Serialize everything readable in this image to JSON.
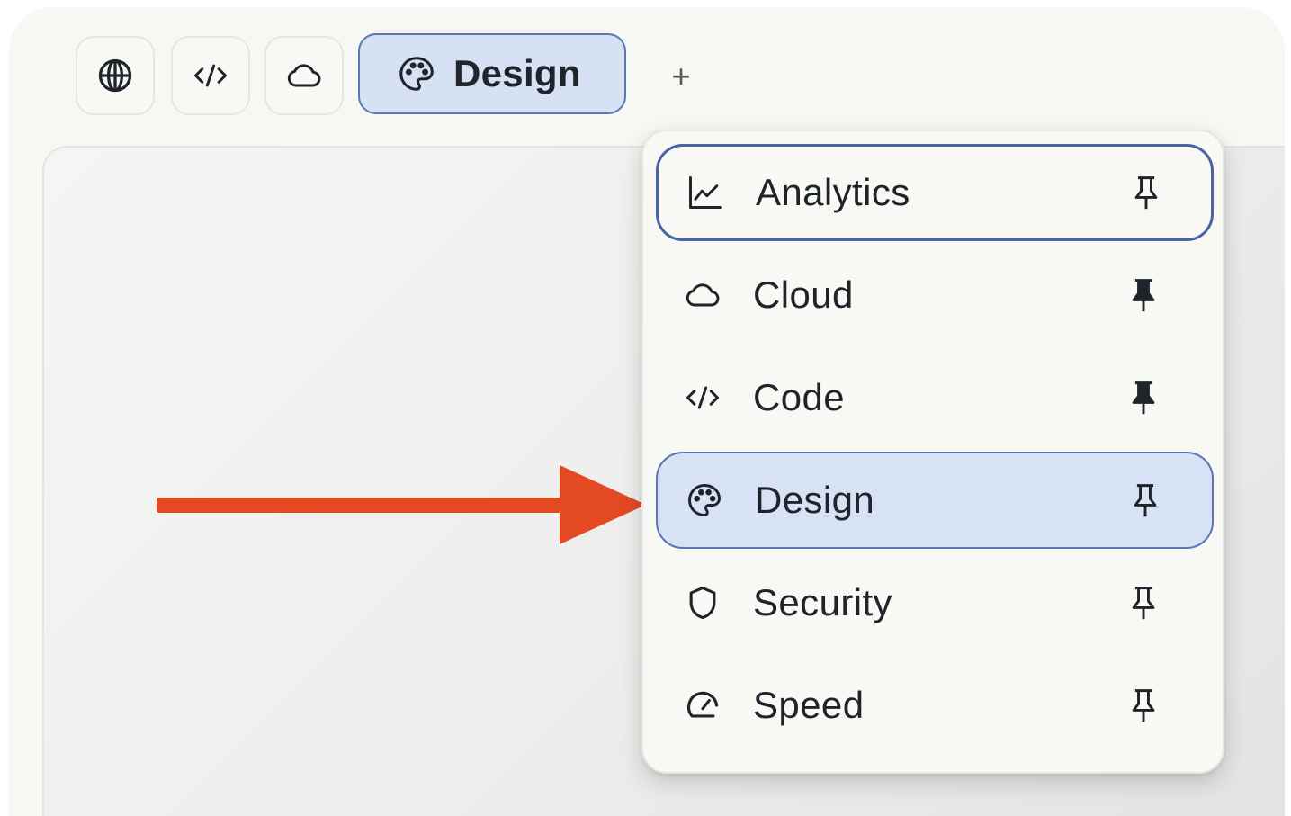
{
  "colors": {
    "frame_bg": "#f7f7f4",
    "accent_border": "#5a77b4",
    "accent_fill": "#d6e1f3",
    "arrow": "#e34a24",
    "text": "#1f232a"
  },
  "tab_bar": {
    "tabs": [
      {
        "icon": "globe-icon",
        "label": ""
      },
      {
        "icon": "code-icon",
        "label": ""
      },
      {
        "icon": "cloud-icon",
        "label": ""
      },
      {
        "icon": "palette-icon",
        "label": "Design",
        "active": true
      }
    ],
    "add_label": "+"
  },
  "menu": {
    "items": [
      {
        "icon": "line-chart-icon",
        "label": "Analytics",
        "pinned": false,
        "focused": true
      },
      {
        "icon": "cloud-icon",
        "label": "Cloud",
        "pinned": true
      },
      {
        "icon": "code-icon",
        "label": "Code",
        "pinned": true
      },
      {
        "icon": "palette-icon",
        "label": "Design",
        "pinned": false,
        "selected": true
      },
      {
        "icon": "shield-icon",
        "label": "Security",
        "pinned": false
      },
      {
        "icon": "gauge-icon",
        "label": "Speed",
        "pinned": false
      }
    ]
  }
}
